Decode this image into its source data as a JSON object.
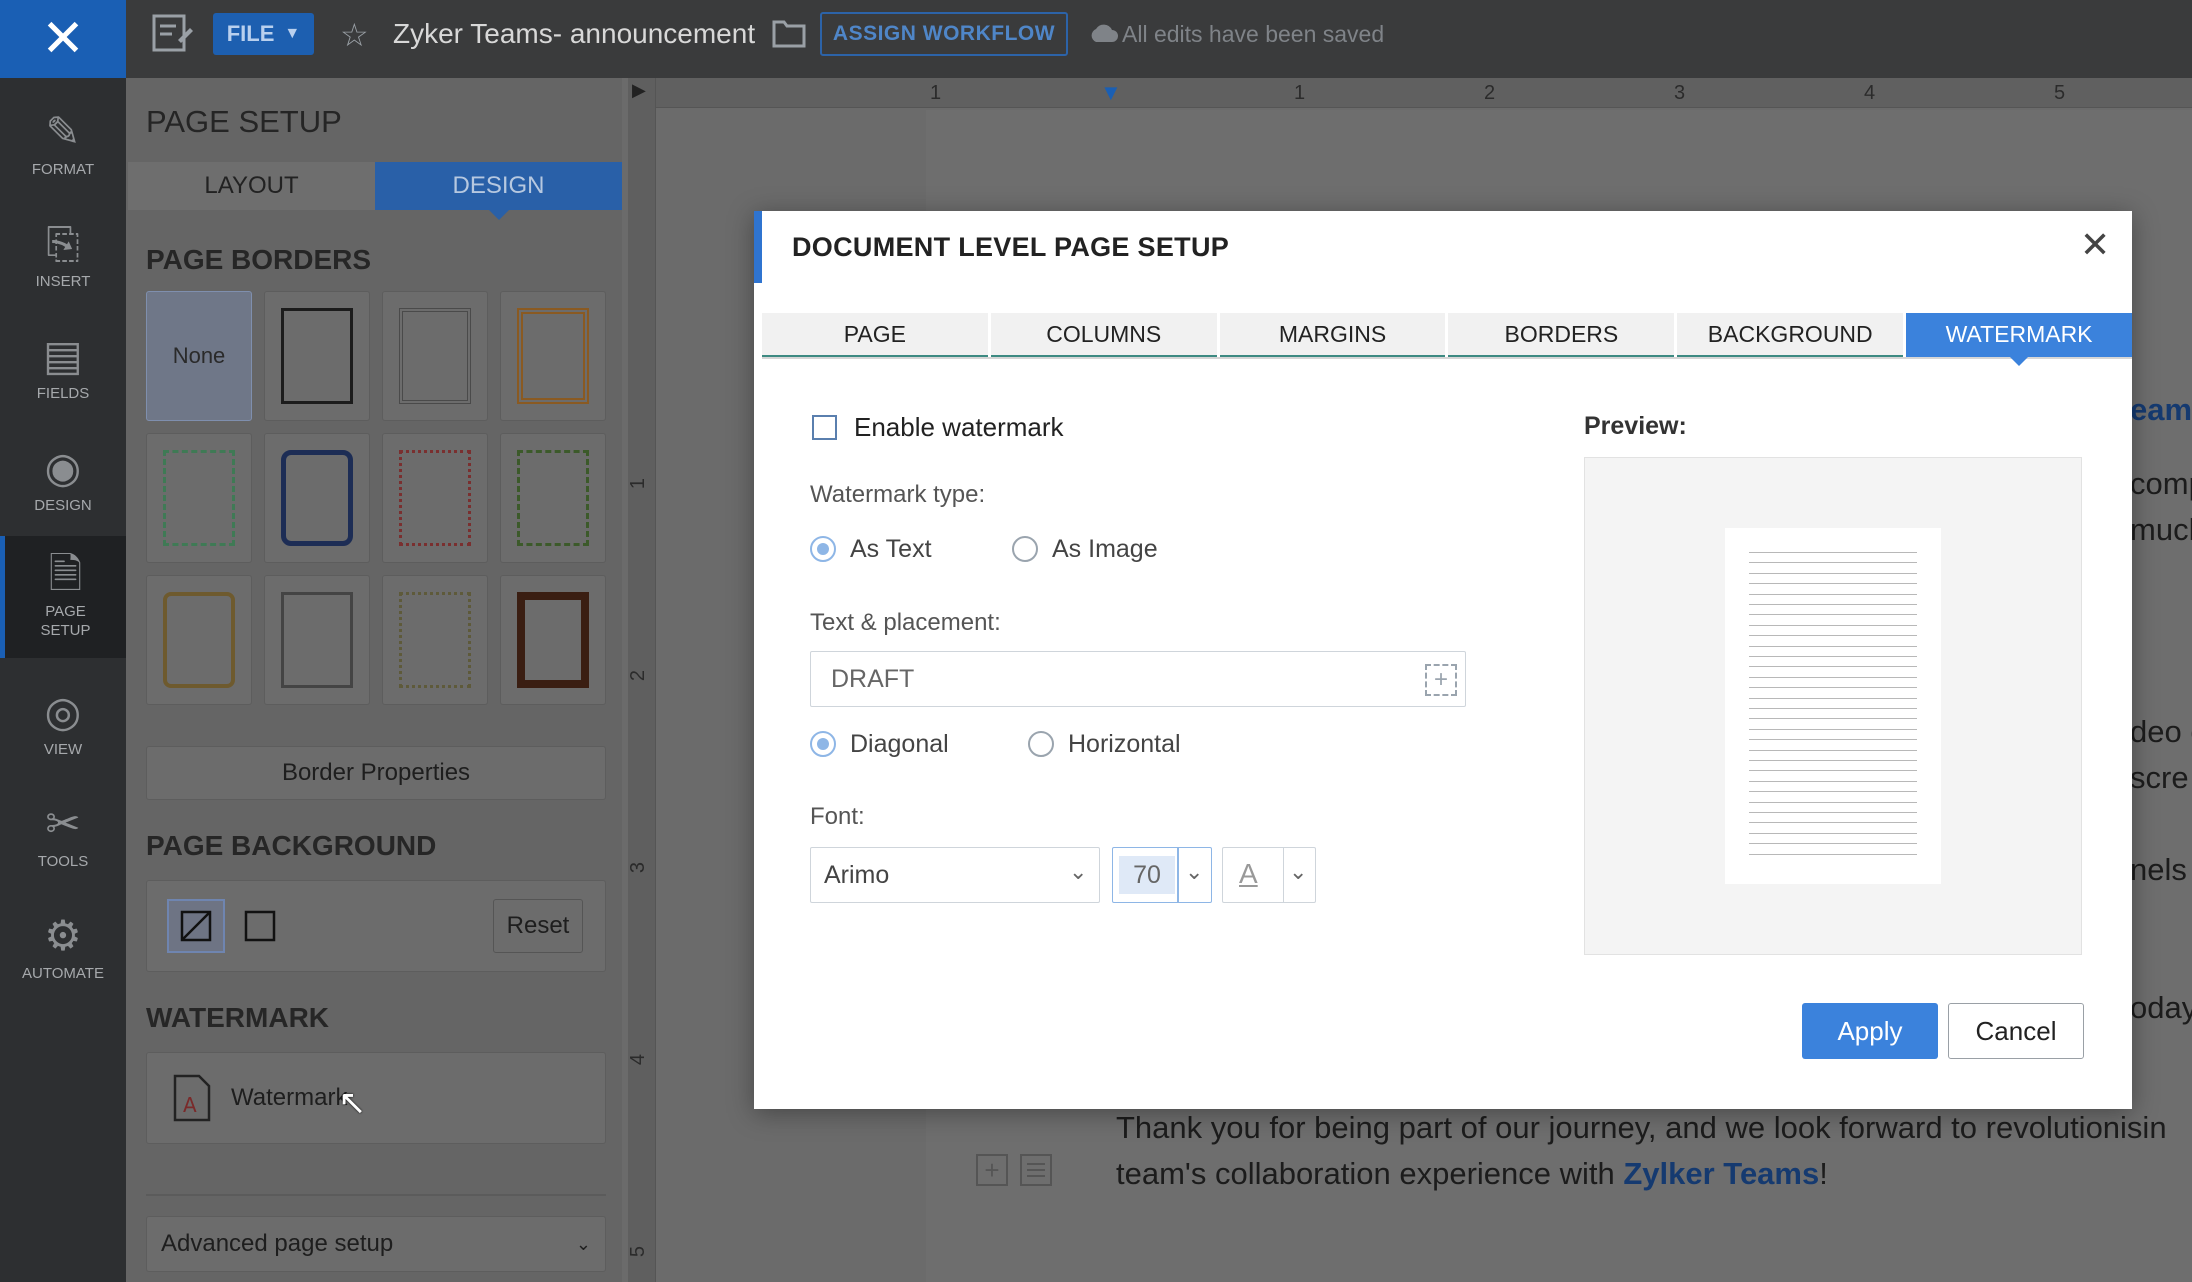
{
  "topbar": {
    "close_icon": "close-icon",
    "doc_icon": "document-icon",
    "file_label": "FILE",
    "star_icon": "star-icon",
    "doc_name": "Zyker Teams- announcement",
    "folder_icon": "folder-icon",
    "workflow_label": "ASSIGN WORKFLOW",
    "cloud_icon": "cloud-icon",
    "saved_text": "All edits have been saved"
  },
  "rail": {
    "items": [
      {
        "label": "FORMAT",
        "icon": "pen-icon"
      },
      {
        "label": "INSERT",
        "icon": "insert-icon"
      },
      {
        "label": "FIELDS",
        "icon": "fields-icon"
      },
      {
        "label": "DESIGN",
        "icon": "palette-icon"
      },
      {
        "label": "PAGE SETUP",
        "label_line1": "PAGE",
        "label_line2": "SETUP",
        "icon": "page-setup-icon"
      },
      {
        "label": "VIEW",
        "icon": "eye-icon"
      },
      {
        "label": "TOOLS",
        "icon": "tools-icon"
      },
      {
        "label": "AUTOMATE",
        "icon": "automate-icon"
      }
    ]
  },
  "panel": {
    "title": "PAGE SETUP",
    "tabs": [
      "LAYOUT",
      "DESIGN"
    ],
    "active_tab": "DESIGN",
    "borders_heading": "PAGE BORDERS",
    "none_label": "None",
    "border_properties": "Border Properties",
    "background_heading": "PAGE BACKGROUND",
    "reset_label": "Reset",
    "watermark_heading": "WATERMARK",
    "watermark_button": "Watermark",
    "advanced_label": "Advanced page setup"
  },
  "ruler": {
    "h_numbers": [
      "1",
      "1",
      "2",
      "3",
      "4",
      "5"
    ],
    "v_numbers": [
      "1",
      "2",
      "3",
      "4",
      "5"
    ]
  },
  "document": {
    "right_fragments": [
      "eams",
      "comp",
      "much",
      "deo c",
      "scre",
      "nels",
      "oday"
    ],
    "line1": "Thank you for being part of our journey, and we look forward to revolutionisin",
    "line2_pre": "team's collaboration experience with ",
    "line2_link": "Zylker Teams",
    "line2_post": "!"
  },
  "dialog": {
    "title": "DOCUMENT LEVEL PAGE SETUP",
    "tabs": [
      "PAGE",
      "COLUMNS",
      "MARGINS",
      "BORDERS",
      "BACKGROUND",
      "WATERMARK"
    ],
    "active_tab": "WATERMARK",
    "enable_label": "Enable watermark",
    "enable_checked": false,
    "type_label": "Watermark type:",
    "type_options": [
      "As Text",
      "As Image"
    ],
    "type_selected": "As Text",
    "text_label": "Text & placement:",
    "text_value": "DRAFT",
    "placement_options": [
      "Diagonal",
      "Horizontal"
    ],
    "placement_selected": "Diagonal",
    "font_label": "Font:",
    "font_value": "Arimo",
    "size_value": "70",
    "color_glyph": "A",
    "preview_label": "Preview:",
    "apply_label": "Apply",
    "cancel_label": "Cancel"
  },
  "colors": {
    "accent": "#3b82dc",
    "brand_dark": "#1a5fb4",
    "link": "#153a70"
  }
}
